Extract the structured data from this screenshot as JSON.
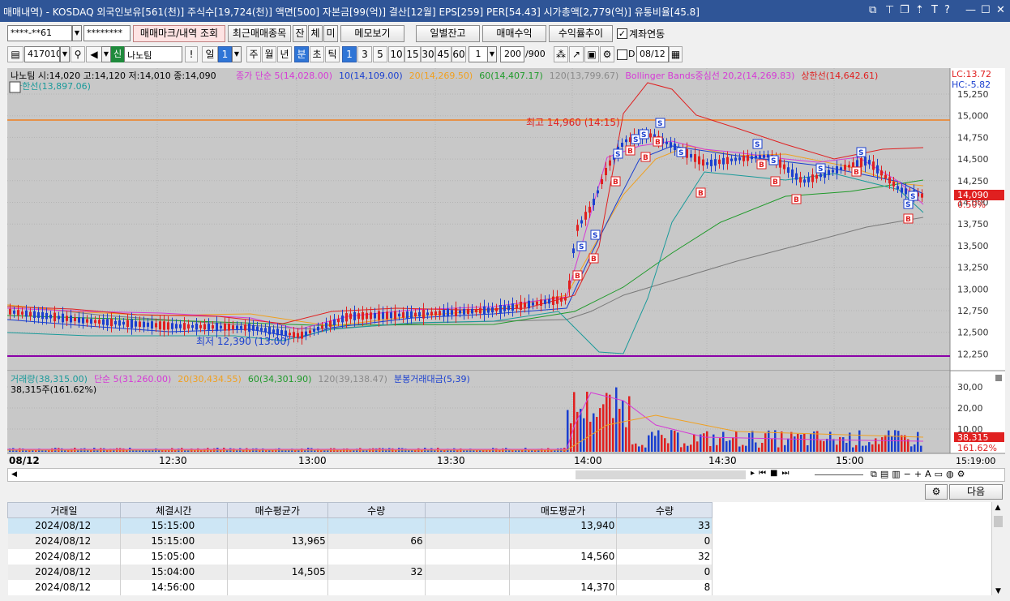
{
  "titlebar": {
    "text": "매매내역) - KOSDAQ 외국인보유[561(천)] 주식수[19,724(천)] 액면[500] 자본금[99(억)] 결산[12월] EPS[259] PER[54.43] 시가총액[2,779(억)] 유통비율[45.8]"
  },
  "toolbar1": {
    "account": "****-**61",
    "password": "********",
    "trade_mark_btn": "매매마크/내역 조회",
    "recent_btn": "최근매매종목",
    "jan_btn": "잔",
    "che_btn": "체",
    "mi_btn": "미",
    "memo_btn": "메모보기",
    "daily_balance_btn": "일별잔고",
    "trade_profit_btn": "매매수익",
    "profit_trend_btn": "수익률추이",
    "account_link_label": "계좌연동",
    "account_link_checked": "✓"
  },
  "toolbar2": {
    "code": "417010",
    "shin_label": "신",
    "stock_name": "나노팀",
    "period_tabs": [
      "일",
      "1",
      "주",
      "월",
      "년",
      "분",
      "초",
      "틱"
    ],
    "minute_btns": [
      "1",
      "3",
      "5",
      "10",
      "15",
      "30",
      "45",
      "60"
    ],
    "count_value": "1",
    "view_count": "200",
    "total_count": "/900",
    "d_label": "D",
    "date": "08/12"
  },
  "chart_header": {
    "price_info": "나노팀 시:14,020 고:14,120 저:14,010 종:14,090",
    "legend_items": [
      {
        "text": "종가 단순 5(14,028.00)",
        "color": "#d63ad6"
      },
      {
        "text": "10(14,109.00)",
        "color": "#1a3fcf"
      },
      {
        "text": "20(14,269.50)",
        "color": "#f0a020"
      },
      {
        "text": "60(14,407.17)",
        "color": "#1f9a2a"
      },
      {
        "text": "120(13,799.67)",
        "color": "#8a8a8a"
      },
      {
        "text": "Bollinger Bands중심선 20,2(14,269.83)",
        "color": "#d63ad6"
      },
      {
        "text": "상한선(14,642.61)",
        "color": "#e02020"
      }
    ],
    "lower_band_label": "하한선(13,897.06)",
    "lc": "LC:13.72",
    "hc": "HC:-5.82",
    "high_annot": "최고 14,960 (14:15)",
    "low_annot": "최저 12,390 (13:00)",
    "current_price": "14,090",
    "current_pct": "0.50%"
  },
  "price_axis": [
    "15,250",
    "15,000",
    "14,750",
    "14,500",
    "14,250",
    "14,000",
    "13,750",
    "13,500",
    "13,250",
    "13,000",
    "12,750",
    "12,500",
    "12,250"
  ],
  "volume_header": {
    "legend_items": [
      {
        "text": "거래량(38,315.00)",
        "color": "#1a9a9a"
      },
      {
        "text": "단순 5(31,260.00)",
        "color": "#d63ad6"
      },
      {
        "text": "20(30,434.55)",
        "color": "#f0a020"
      },
      {
        "text": "60(34,301.90)",
        "color": "#1f9a2a"
      },
      {
        "text": "120(39,138.47)",
        "color": "#8a8a8a"
      },
      {
        "text": "분봉거래대금(5,39)",
        "color": "#1a3fcf"
      }
    ],
    "sub": "38,315주(161.62%)",
    "current_volume": "38,315",
    "current_volume_pct": "161.62%"
  },
  "volume_axis": [
    "30,00",
    "20,00",
    "10,00"
  ],
  "time_axis": {
    "date": "08/12",
    "labels": [
      "12:30",
      "13:00",
      "13:30",
      "14:00",
      "14:30",
      "15:00"
    ],
    "last": "15:19:00"
  },
  "bottom_bar": {
    "settings_icon": "gear-icon",
    "next_btn": "다음"
  },
  "table": {
    "columns": [
      "거래일",
      "체결시간",
      "매수평균가",
      "수량",
      "",
      "매도평균가",
      "수량"
    ],
    "rows": [
      [
        "2024/08/12",
        "15:15:00",
        "",
        "",
        "",
        "13,940",
        "33"
      ],
      [
        "2024/08/12",
        "15:15:00",
        "13,965",
        "66",
        "",
        "",
        "0"
      ],
      [
        "2024/08/12",
        "15:05:00",
        "",
        "",
        "",
        "14,560",
        "32"
      ],
      [
        "2024/08/12",
        "15:04:00",
        "14,505",
        "32",
        "",
        "",
        "0"
      ],
      [
        "2024/08/12",
        "14:56:00",
        "",
        "",
        "",
        "14,370",
        "8"
      ]
    ]
  },
  "colors": {
    "titlebar": "#2f5597",
    "up": "#e02020",
    "down": "#1a3fcf",
    "selected_row": "#cde6f5",
    "alt_row": "#ececec"
  }
}
